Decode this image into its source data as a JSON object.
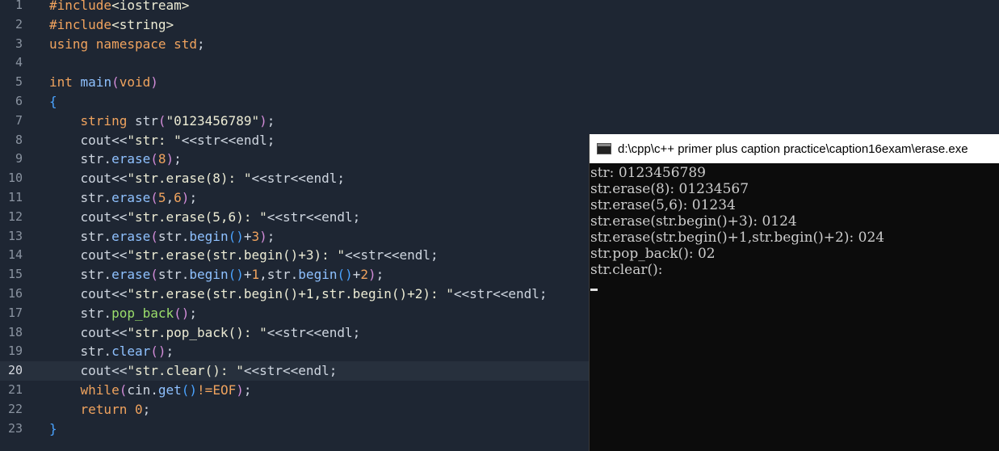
{
  "editor": {
    "active_line": 20,
    "lines": [
      {
        "n": "1",
        "tokens": [
          {
            "t": "#include",
            "c": "kw"
          },
          {
            "t": "<iostream>",
            "c": "str"
          }
        ]
      },
      {
        "n": "2",
        "tokens": [
          {
            "t": "#include",
            "c": "kw"
          },
          {
            "t": "<string>",
            "c": "str"
          }
        ]
      },
      {
        "n": "3",
        "tokens": [
          {
            "t": "using namespace std",
            "c": "kw"
          },
          {
            "t": ";",
            "c": "pun"
          }
        ]
      },
      {
        "n": "4",
        "tokens": []
      },
      {
        "n": "5",
        "tokens": [
          {
            "t": "int",
            "c": "typ"
          },
          {
            "t": " main",
            "c": "fn"
          },
          {
            "t": "(",
            "c": "br2"
          },
          {
            "t": "void",
            "c": "typ"
          },
          {
            "t": ")",
            "c": "br2"
          }
        ]
      },
      {
        "n": "6",
        "tokens": [
          {
            "t": "{",
            "c": "br"
          }
        ]
      },
      {
        "n": "7",
        "tokens": [
          {
            "t": "    "
          },
          {
            "t": "string",
            "c": "typ"
          },
          {
            "t": " str",
            "c": "id"
          },
          {
            "t": "(",
            "c": "br2"
          },
          {
            "t": "\"0123456789\"",
            "c": "str"
          },
          {
            "t": ")",
            "c": "br2"
          },
          {
            "t": ";",
            "c": "pun"
          }
        ]
      },
      {
        "n": "8",
        "tokens": [
          {
            "t": "    "
          },
          {
            "t": "cout",
            "c": "id"
          },
          {
            "t": "<<",
            "c": "pun"
          },
          {
            "t": "\"str: \"",
            "c": "str"
          },
          {
            "t": "<<str<<endl;",
            "c": "id"
          }
        ]
      },
      {
        "n": "9",
        "tokens": [
          {
            "t": "    "
          },
          {
            "t": "str.",
            "c": "id"
          },
          {
            "t": "erase",
            "c": "fn"
          },
          {
            "t": "(",
            "c": "br2"
          },
          {
            "t": "8",
            "c": "num"
          },
          {
            "t": ")",
            "c": "br2"
          },
          {
            "t": ";",
            "c": "pun"
          }
        ]
      },
      {
        "n": "10",
        "tokens": [
          {
            "t": "    "
          },
          {
            "t": "cout",
            "c": "id"
          },
          {
            "t": "<<",
            "c": "pun"
          },
          {
            "t": "\"str.erase(8): \"",
            "c": "str"
          },
          {
            "t": "<<str<<endl;",
            "c": "id"
          }
        ]
      },
      {
        "n": "11",
        "tokens": [
          {
            "t": "    "
          },
          {
            "t": "str.",
            "c": "id"
          },
          {
            "t": "erase",
            "c": "fn"
          },
          {
            "t": "(",
            "c": "br2"
          },
          {
            "t": "5",
            "c": "num"
          },
          {
            "t": ",",
            "c": "pun"
          },
          {
            "t": "6",
            "c": "num"
          },
          {
            "t": ")",
            "c": "br2"
          },
          {
            "t": ";",
            "c": "pun"
          }
        ]
      },
      {
        "n": "12",
        "tokens": [
          {
            "t": "    "
          },
          {
            "t": "cout",
            "c": "id"
          },
          {
            "t": "<<",
            "c": "pun"
          },
          {
            "t": "\"str.erase(5,6): \"",
            "c": "str"
          },
          {
            "t": "<<str<<endl;",
            "c": "id"
          }
        ]
      },
      {
        "n": "13",
        "tokens": [
          {
            "t": "    "
          },
          {
            "t": "str.",
            "c": "id"
          },
          {
            "t": "erase",
            "c": "fn"
          },
          {
            "t": "(",
            "c": "br2"
          },
          {
            "t": "str.",
            "c": "id"
          },
          {
            "t": "begin",
            "c": "fn"
          },
          {
            "t": "()",
            "c": "br"
          },
          {
            "t": "+",
            "c": "pun"
          },
          {
            "t": "3",
            "c": "num"
          },
          {
            "t": ")",
            "c": "br2"
          },
          {
            "t": ";",
            "c": "pun"
          }
        ]
      },
      {
        "n": "14",
        "tokens": [
          {
            "t": "    "
          },
          {
            "t": "cout",
            "c": "id"
          },
          {
            "t": "<<",
            "c": "pun"
          },
          {
            "t": "\"str.erase(str.begin()+3): \"",
            "c": "str"
          },
          {
            "t": "<<str<<endl;",
            "c": "id"
          }
        ]
      },
      {
        "n": "15",
        "tokens": [
          {
            "t": "    "
          },
          {
            "t": "str.",
            "c": "id"
          },
          {
            "t": "erase",
            "c": "fn"
          },
          {
            "t": "(",
            "c": "br2"
          },
          {
            "t": "str.",
            "c": "id"
          },
          {
            "t": "begin",
            "c": "fn"
          },
          {
            "t": "()",
            "c": "br"
          },
          {
            "t": "+",
            "c": "pun"
          },
          {
            "t": "1",
            "c": "num"
          },
          {
            "t": ",",
            "c": "pun"
          },
          {
            "t": "str.",
            "c": "id"
          },
          {
            "t": "begin",
            "c": "fn"
          },
          {
            "t": "()",
            "c": "br"
          },
          {
            "t": "+",
            "c": "pun"
          },
          {
            "t": "2",
            "c": "num"
          },
          {
            "t": ")",
            "c": "br2"
          },
          {
            "t": ";",
            "c": "pun"
          }
        ]
      },
      {
        "n": "16",
        "tokens": [
          {
            "t": "    "
          },
          {
            "t": "cout",
            "c": "id"
          },
          {
            "t": "<<",
            "c": "pun"
          },
          {
            "t": "\"str.erase(str.begin()+1,str.begin()+2): \"",
            "c": "str"
          },
          {
            "t": "<<str<<endl;",
            "c": "id"
          }
        ]
      },
      {
        "n": "17",
        "tokens": [
          {
            "t": "    "
          },
          {
            "t": "str.",
            "c": "id"
          },
          {
            "t": "pop_back",
            "c": "grn"
          },
          {
            "t": "()",
            "c": "br2"
          },
          {
            "t": ";",
            "c": "pun"
          }
        ]
      },
      {
        "n": "18",
        "tokens": [
          {
            "t": "    "
          },
          {
            "t": "cout",
            "c": "id"
          },
          {
            "t": "<<",
            "c": "pun"
          },
          {
            "t": "\"str.pop_back(): \"",
            "c": "str"
          },
          {
            "t": "<<str<<endl;",
            "c": "id"
          }
        ]
      },
      {
        "n": "19",
        "tokens": [
          {
            "t": "    "
          },
          {
            "t": "str.",
            "c": "id"
          },
          {
            "t": "clear",
            "c": "fn"
          },
          {
            "t": "()",
            "c": "br2"
          },
          {
            "t": ";",
            "c": "pun"
          }
        ]
      },
      {
        "n": "20",
        "tokens": [
          {
            "t": "    "
          },
          {
            "t": "cout",
            "c": "id"
          },
          {
            "t": "<<",
            "c": "pun"
          },
          {
            "t": "\"str.clear(): \"",
            "c": "str"
          },
          {
            "t": "<<str<<endl;",
            "c": "id"
          }
        ]
      },
      {
        "n": "21",
        "tokens": [
          {
            "t": "    "
          },
          {
            "t": "while",
            "c": "kw"
          },
          {
            "t": "(",
            "c": "br2"
          },
          {
            "t": "cin.",
            "c": "id"
          },
          {
            "t": "get",
            "c": "fn"
          },
          {
            "t": "()",
            "c": "br"
          },
          {
            "t": "!=",
            "c": "kw"
          },
          {
            "t": "EOF",
            "c": "typ"
          },
          {
            "t": ")",
            "c": "br2"
          },
          {
            "t": ";",
            "c": "pun"
          }
        ]
      },
      {
        "n": "22",
        "tokens": [
          {
            "t": "    "
          },
          {
            "t": "return",
            "c": "kw"
          },
          {
            "t": " ",
            "c": "id"
          },
          {
            "t": "0",
            "c": "num"
          },
          {
            "t": ";",
            "c": "pun"
          }
        ]
      },
      {
        "n": "23",
        "tokens": [
          {
            "t": "}",
            "c": "br"
          }
        ]
      }
    ]
  },
  "console": {
    "title": "d:\\cpp\\c++ primer plus caption practice\\caption16exam\\erase.exe",
    "output": [
      "str: 0123456789",
      "str.erase(8): 01234567",
      "str.erase(5,6): 01234",
      "str.erase(str.begin()+3): 0124",
      "str.erase(str.begin()+1,str.begin()+2): 024",
      "str.pop_back(): 02",
      "str.clear():"
    ]
  }
}
